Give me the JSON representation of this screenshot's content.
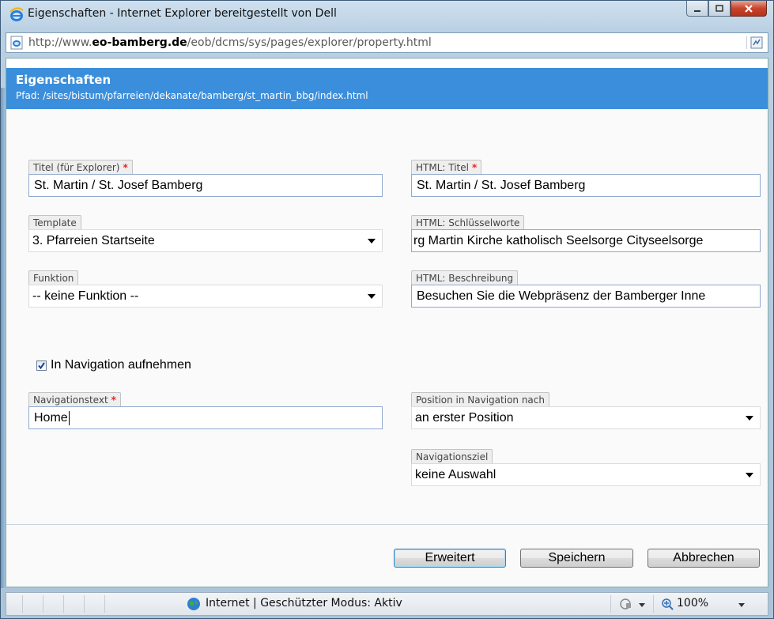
{
  "window": {
    "title": "Eigenschaften - Internet Explorer bereitgestellt von Dell",
    "address_prefix": "http://www.",
    "address_domain": "eo-bamberg.de",
    "address_path": "/eob/dcms/sys/pages/explorer/property.html"
  },
  "header": {
    "title": "Eigenschaften",
    "path": "Pfad: /sites/bistum/pfarreien/dekanate/bamberg/st_martin_bbg/index.html"
  },
  "form": {
    "titel_label": "Titel (für Explorer)",
    "titel_value": "St. Martin / St. Josef Bamberg",
    "html_titel_label": "HTML: Titel",
    "html_titel_value": "St. Martin / St. Josef Bamberg",
    "template_label": "Template",
    "template_value": "3. Pfarreien Startseite",
    "keywords_label": "HTML: Schlüsselworte",
    "keywords_value": "rg Martin Kirche katholisch Seelsorge Cityseelsorge",
    "funktion_label": "Funktion",
    "funktion_value": "-- keine Funktion --",
    "description_label": "HTML: Beschreibung",
    "description_value": "Besuchen Sie die Webpräsenz der Bamberger Inne",
    "navigation_checkbox_label": "In Navigation aufnehmen",
    "navigation_checkbox_checked": true,
    "navtext_label": "Navigationstext",
    "navtext_value": "Home",
    "position_label": "Position in Navigation nach",
    "position_value": "an erster Position",
    "navziel_label": "Navigationsziel",
    "navziel_value": "keine Auswahl",
    "required_mark": "*"
  },
  "buttons": {
    "advanced": "Erweitert",
    "save": "Speichern",
    "cancel": "Abbrechen"
  },
  "statusbar": {
    "zone_text": "Internet | Geschützter Modus: Aktiv",
    "zoom": "100%"
  },
  "colors": {
    "header_bg": "#3b8edb",
    "required": "#e22222"
  }
}
